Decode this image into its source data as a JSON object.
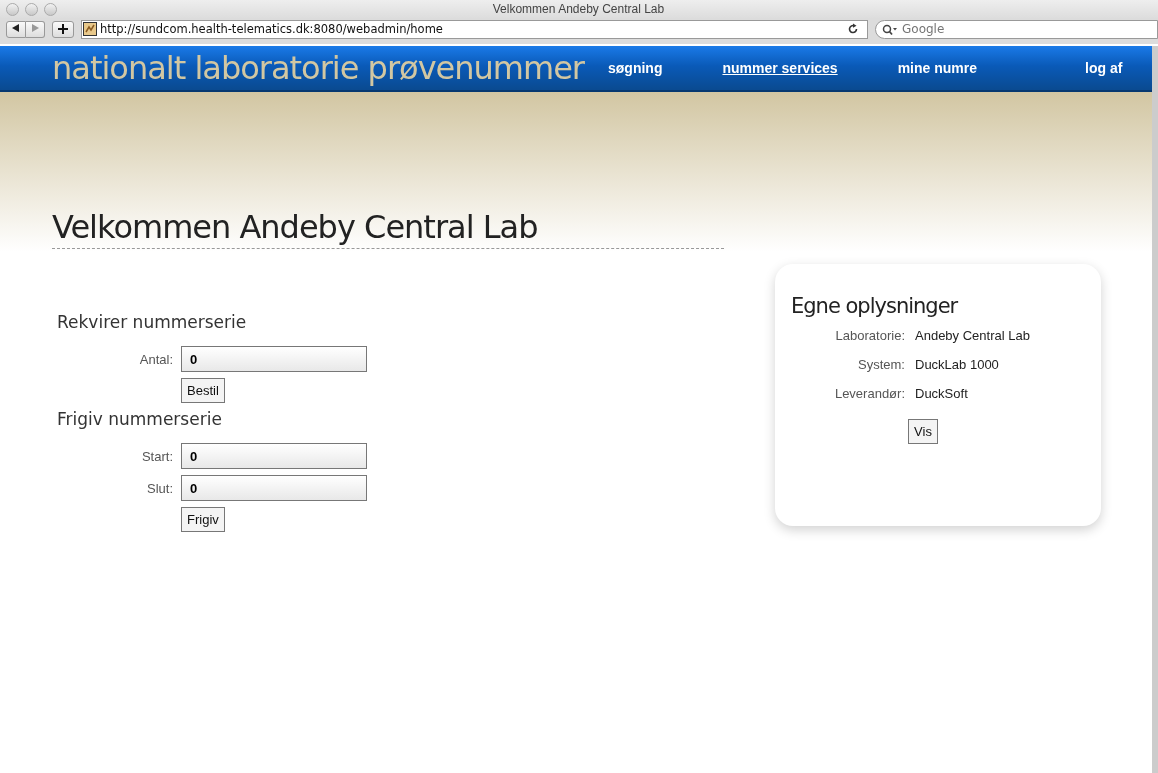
{
  "window": {
    "title": "Velkommen Andeby Central Lab"
  },
  "toolbar": {
    "url": "http://sundcom.health-telematics.dk:8080/webadmin/home",
    "search": {
      "placeholder": "Google"
    }
  },
  "site": {
    "logo": "nationalt laboratorie prøvenummer",
    "nav": [
      {
        "label": "søgning",
        "selected": false
      },
      {
        "label": "nummer services",
        "selected": true
      },
      {
        "label": "mine numre",
        "selected": false
      },
      {
        "label": "log af",
        "selected": false
      }
    ]
  },
  "heading": "Velkommen Andeby Central Lab",
  "forms": [
    {
      "title": "Rekvirer nummerserie",
      "fields": [
        {
          "label": "Antal:",
          "value": "0"
        }
      ],
      "button": "Bestil"
    },
    {
      "title": "Frigiv nummerserie",
      "fields": [
        {
          "label": "Start:",
          "value": "0"
        },
        {
          "label": "Slut:",
          "value": "0"
        }
      ],
      "button": "Frigiv"
    }
  ],
  "info": {
    "title": "Egne oplysninger",
    "rows": [
      {
        "label": "Laboratorie:",
        "value": "Andeby Central Lab"
      },
      {
        "label": "System:",
        "value": "DuckLab 1000"
      },
      {
        "label": "Leverandør:",
        "value": "DuckSoft"
      }
    ],
    "button": "Vis"
  }
}
